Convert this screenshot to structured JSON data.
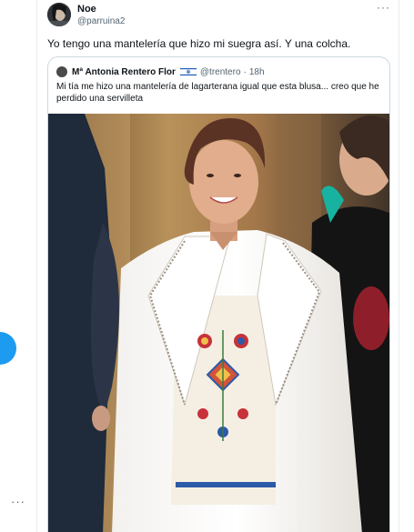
{
  "tweet": {
    "author_name": "Noe",
    "author_handle": "@parruina2",
    "text": "Yo tengo una mantelería que hizo mi suegra así. Y una colcha.",
    "more_label": "···"
  },
  "quoted_tweet": {
    "author_name": "Mª Antonia Rentero Flor",
    "author_handle": "@trentero",
    "separator": "·",
    "time": "18h",
    "text": "Mi tía me hizo una mantelería de lagarterana igual que esta blusa... creo que he perdido una servilleta",
    "flag_icon": "israel-flag-icon",
    "photo_icon": "woman-embroidered-blouse-photo"
  },
  "sidebar": {
    "more_label": "···",
    "fab_color": "#1d9bf0"
  },
  "colors": {
    "accent": "#1d9bf0",
    "text": "#0f1419",
    "secondary_text": "#536471",
    "border": "#cfd9de"
  }
}
